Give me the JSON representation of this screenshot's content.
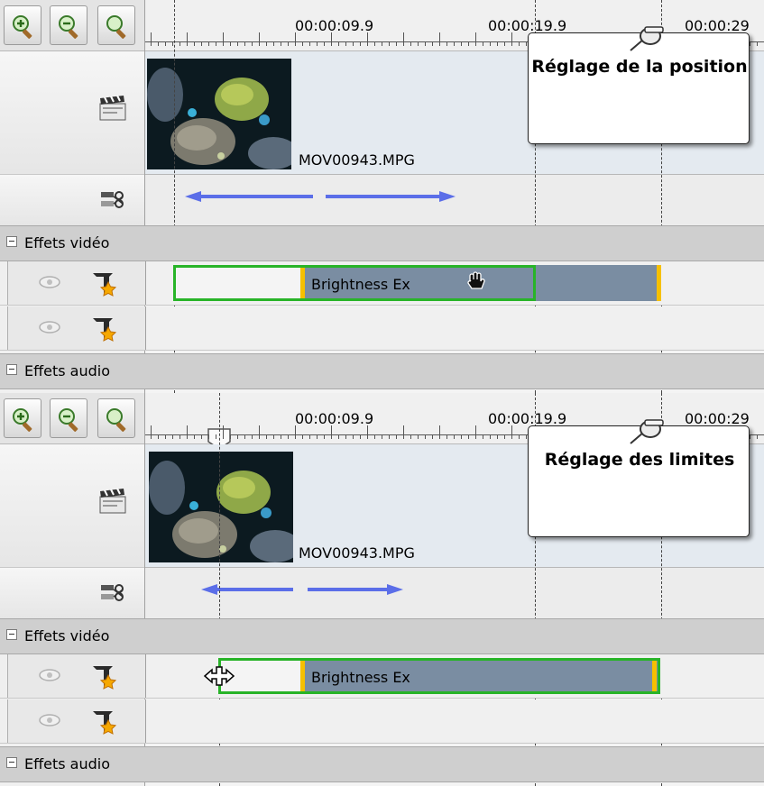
{
  "panels": [
    {
      "id": "position",
      "ruler": {
        "time_1": "00:00:09.9",
        "time_2": "00:00:19.9",
        "time_3": "00:00:29"
      },
      "clip": {
        "filename": "MOV00943.MPG"
      },
      "sections": {
        "video_effects": "Effets vidéo",
        "audio_effects": "Effets audio"
      },
      "effect": {
        "label": "Brightness Ex"
      },
      "callout": {
        "text": "Réglage de la position"
      }
    },
    {
      "id": "limits",
      "ruler": {
        "time_1": "00:00:09.9",
        "time_2": "00:00:19.9",
        "time_3": "00:00:29"
      },
      "clip": {
        "filename": "MOV00943.MPG"
      },
      "sections": {
        "video_effects": "Effets vidéo",
        "audio_effects": "Effets audio"
      },
      "effect": {
        "label": "Brightness Ex"
      },
      "callout": {
        "text": "Réglage des limites"
      }
    }
  ],
  "icons": [
    "zoom-in-icon",
    "zoom-out-icon",
    "zoom-fit-icon",
    "clapperboard-icon",
    "audio-split-icon",
    "eye-icon",
    "effect-star-icon",
    "pushpin-icon",
    "hand-cursor-icon",
    "resize-cursor-icon"
  ],
  "colors": {
    "effect_border": "#28b428",
    "effect_fill": "#7a8da2",
    "effect_marker": "#f6c000",
    "arrow": "#5b6ee8"
  }
}
